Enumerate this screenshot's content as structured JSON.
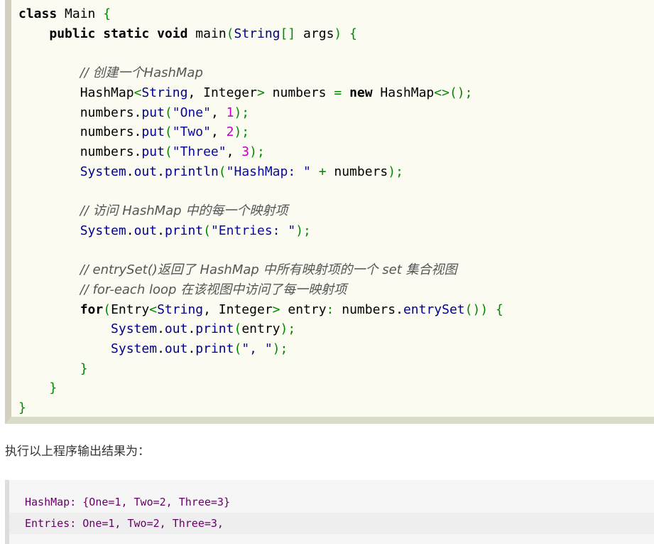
{
  "code": {
    "lines": [
      "class Main {",
      "    public static void main(String[] args) {",
      "",
      "        // 创建一个HashMap",
      "        HashMap<String, Integer> numbers = new HashMap<>();",
      "        numbers.put(\"One\", 1);",
      "        numbers.put(\"Two\", 2);",
      "        numbers.put(\"Three\", 3);",
      "        System.out.println(\"HashMap: \" + numbers);",
      "",
      "        // 访问 HashMap 中的每一个映射项",
      "        System.out.print(\"Entries: \");",
      "",
      "        // entrySet()返回了 HashMap 中所有映射项的一个 set 集合视图",
      "        // for-each loop 在该视图中访问了每一映射项",
      "        for(Entry<String, Integer> entry: numbers.entrySet()) {",
      "            System.out.print(entry);",
      "            System.out.print(\", \");",
      "        }",
      "    }",
      "}"
    ],
    "comment_create": "// 创建一个HashMap",
    "comment_access": "// 访问 HashMap 中的每一个映射项",
    "comment_entryset": "// entrySet()返回了 HashMap 中所有映射项的一个 set 集合视图",
    "comment_foreach": "// for-each loop 在该视图中访问了每一映射项"
  },
  "result_label": "执行以上程序输出结果为：",
  "output": {
    "line1": "HashMap: {One=1, Two=2, Three=3}",
    "line2": "Entries: One=1, Two=2, Three=3,"
  },
  "colors": {
    "code_bg": "#fbfbf2",
    "code_border": "#d4d0bf",
    "output_bg": "#f6f6f6"
  }
}
